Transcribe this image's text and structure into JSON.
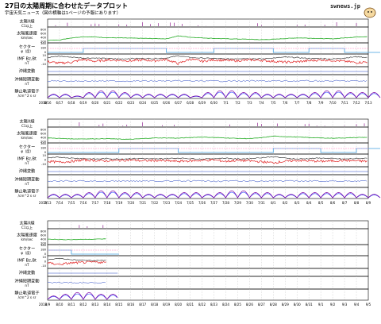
{
  "header": {
    "title": "27日の太陽周期に合わせたデータプロット",
    "subtitle": "宇宙天気ニュース（図の横軸は1ページの予報にあります）",
    "logo_text": "swnews.jp"
  },
  "panel_labels": [
    [
      "太陽X線",
      "C1以上"
    ],
    [
      "太陽風速度",
      "km/sec"
    ],
    [
      "セクター",
      "φ（度）"
    ],
    [
      "IMF Bz,Bt",
      "nT"
    ],
    [
      "沖縄変動",
      ""
    ],
    [
      "沖縄短期変動",
      "nT"
    ],
    [
      "静止軌道電子",
      "/cm^2 s sr"
    ]
  ],
  "axis_ticks": {
    "wind": [
      "800",
      "600",
      "400",
      "200"
    ],
    "sector": [
      "360",
      "180",
      "0"
    ],
    "imf": [
      "10",
      "0",
      "-10"
    ]
  },
  "colors": {
    "xray": "#800080",
    "wind": "#22aa22",
    "sector_a": "#40a0e0",
    "sector_b": "#ff80c0",
    "imf_bz": "#e02020",
    "imf_bt": "#202020",
    "magnet": "#2040c0",
    "electron_a": "#8000a0",
    "electron_b": "#2040ff",
    "grid": "#bfbfbf",
    "frame": "#000000"
  },
  "chart_data": [
    {
      "type": "line",
      "year_label": "2018",
      "dates": [
        "6/16",
        "6/17",
        "6/18",
        "6/19",
        "6/20",
        "6/21",
        "6/22",
        "6/23",
        "6/24",
        "6/25",
        "6/26",
        "6/27",
        "6/28",
        "6/29",
        "6/30",
        "7/1",
        "7/2",
        "7/3",
        "7/4",
        "7/5",
        "7/6",
        "7/7",
        "7/8",
        "7/9",
        "7/10",
        "7/11",
        "7/12",
        "7/13"
      ],
      "ylim_wind": [
        200,
        900
      ],
      "series": [
        {
          "name": "太陽風速度",
          "values": [
            310,
            330,
            420,
            470,
            460,
            430,
            420,
            410,
            400,
            390,
            380,
            510,
            450,
            420,
            400,
            380,
            370,
            360,
            340,
            360,
            390,
            420,
            410,
            390,
            380,
            420,
            460,
            480
          ]
        },
        {
          "name": "セクター",
          "values": [
            0,
            0,
            0,
            180,
            180,
            180,
            180,
            180,
            180,
            180,
            0,
            0,
            0,
            0,
            180,
            180,
            180,
            180,
            180,
            0,
            0,
            0,
            180,
            180,
            180,
            0,
            0,
            0
          ]
        },
        {
          "name": "IMF Bz",
          "values": [
            -3,
            -6,
            -4,
            2,
            -2,
            1,
            0,
            -1,
            1,
            -1,
            2,
            -7,
            3,
            -2,
            1,
            0,
            -1,
            1,
            0,
            -2,
            -4,
            -3,
            -1,
            1,
            0,
            -2,
            -5,
            -3
          ]
        },
        {
          "name": "静止軌道電子",
          "values": [
            5,
            5,
            4,
            6,
            7,
            7,
            6,
            5,
            5,
            5,
            5,
            5,
            4,
            6,
            7,
            7,
            6,
            6,
            5,
            5,
            5,
            5,
            6,
            7,
            7,
            6,
            6,
            6
          ]
        }
      ]
    },
    {
      "type": "line",
      "year_label": "2018",
      "dates": [
        "7/13",
        "7/14",
        "7/15",
        "7/16",
        "7/17",
        "7/18",
        "7/19",
        "7/20",
        "7/21",
        "7/22",
        "7/23",
        "7/24",
        "7/25",
        "7/26",
        "7/27",
        "7/28",
        "7/29",
        "7/30",
        "7/31",
        "8/1",
        "8/2",
        "8/3",
        "8/4",
        "8/5",
        "8/6",
        "8/7",
        "8/8",
        "8/9"
      ],
      "ylim_wind": [
        200,
        900
      ],
      "series": [
        {
          "name": "太陽風速度",
          "values": [
            420,
            400,
            380,
            380,
            380,
            390,
            370,
            360,
            390,
            420,
            420,
            410,
            440,
            460,
            440,
            420,
            400,
            390,
            430,
            500,
            480,
            460,
            440,
            420,
            410,
            420,
            440,
            450
          ]
        },
        {
          "name": "セクター",
          "values": [
            0,
            0,
            0,
            0,
            0,
            0,
            180,
            180,
            180,
            180,
            180,
            0,
            0,
            0,
            0,
            0,
            0,
            0,
            0,
            180,
            180,
            180,
            180,
            0,
            0,
            0,
            180,
            180
          ]
        },
        {
          "name": "IMF Bz",
          "values": [
            -2,
            -4,
            -2,
            1,
            0,
            -1,
            0,
            1,
            -1,
            0,
            -1,
            -2,
            -1,
            0,
            1,
            -2,
            0,
            -1,
            -3,
            -5,
            -2,
            0,
            -1,
            -2,
            -1,
            0,
            -1,
            -2
          ]
        },
        {
          "name": "静止軌道電子",
          "values": [
            5,
            5,
            5,
            6,
            7,
            7,
            6,
            6,
            5,
            5,
            5,
            6,
            6,
            5,
            6,
            7,
            7,
            6,
            6,
            5,
            5,
            6,
            6,
            6,
            6,
            6,
            5,
            5
          ]
        }
      ]
    },
    {
      "type": "line",
      "year_label": "2018",
      "dates": [
        "8/9",
        "8/10",
        "8/11",
        "8/12",
        "8/13",
        "8/14",
        "8/15",
        "8/16",
        "8/17",
        "8/18",
        "8/19",
        "8/20",
        "8/21",
        "8/22",
        "8/23",
        "8/24",
        "8/25",
        "8/26",
        "8/27",
        "8/28",
        "8/29",
        "8/30",
        "8/31",
        "9/1",
        "9/2",
        "9/3",
        "9/4",
        "9/5"
      ],
      "ylim_wind": [
        200,
        900
      ],
      "series": [
        {
          "name": "太陽風速度",
          "values": [
            450,
            420,
            420,
            430,
            440,
            450
          ]
        },
        {
          "name": "セクター",
          "values": [
            180,
            180,
            0,
            0,
            0,
            0
          ]
        },
        {
          "name": "IMF Bz",
          "values": [
            -2,
            -5,
            -2,
            -1,
            0,
            -1
          ]
        },
        {
          "name": "静止軌道電子",
          "values": [
            5,
            6,
            7,
            7,
            6,
            6
          ]
        }
      ]
    }
  ]
}
